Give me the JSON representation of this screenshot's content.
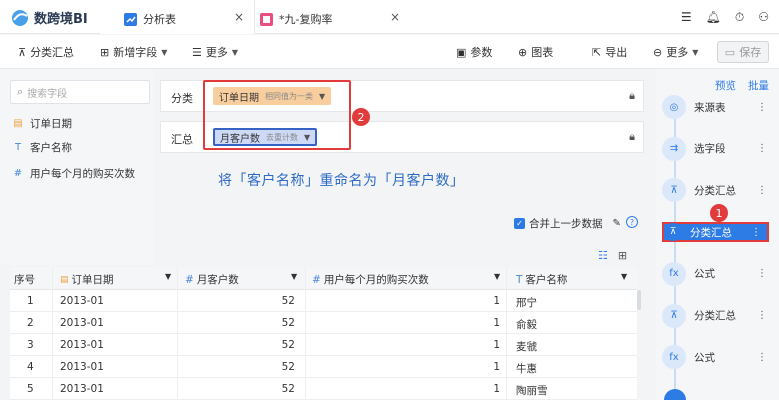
{
  "app": {
    "name": "数跨境BI"
  },
  "tabs": [
    {
      "label": "分析表",
      "close": "×"
    },
    {
      "label": "*九-复购率",
      "close": "×"
    }
  ],
  "toolbar": {
    "group_summary": "分类汇总",
    "add_field": "新增字段",
    "more_left": "更多",
    "params": "参数",
    "chart": "图表",
    "export": "导出",
    "more_right": "更多",
    "save": "保存"
  },
  "left_panel": {
    "search_placeholder": "搜索字段",
    "fields": [
      {
        "icon": "date-icon",
        "label": "订单日期"
      },
      {
        "icon": "text-icon",
        "label": "客户名称"
      },
      {
        "icon": "number-icon",
        "label": "用户每个月的购买次数"
      }
    ]
  },
  "config": {
    "group_label": "分类",
    "group_pill": {
      "label": "订单日期",
      "sub": "相同值为一类"
    },
    "summary_label": "汇总",
    "summary_pill": {
      "label": "月客户数",
      "sub": "去重计数"
    },
    "badge_2": "2"
  },
  "annotation": "将「客户名称」重命名为「月客户数」",
  "merge_label": "合并上一步数据",
  "table": {
    "headers": [
      "序号",
      "订单日期",
      "月客户数",
      "用户每个月的购买次数",
      "客户名称"
    ],
    "rows": [
      [
        "1",
        "2013-01",
        "52",
        "1",
        "邢宁"
      ],
      [
        "2",
        "2013-01",
        "52",
        "1",
        "俞毅"
      ],
      [
        "3",
        "2013-01",
        "52",
        "1",
        "麦虢"
      ],
      [
        "4",
        "2013-01",
        "52",
        "1",
        "牛惠"
      ],
      [
        "5",
        "2013-01",
        "52",
        "1",
        "陶丽雪"
      ]
    ]
  },
  "right_panel": {
    "preview": "预览",
    "batch": "批量",
    "badge_1": "1",
    "steps": [
      "来源表",
      "选字段",
      "分类汇总",
      "分类汇总",
      "公式",
      "分类汇总",
      "公式"
    ]
  },
  "colors": {
    "accent": "#2d7be5",
    "highlight": "#e23b3b",
    "date_pill": "#f8ce9e",
    "measure_pill": "#cdd9f5"
  }
}
